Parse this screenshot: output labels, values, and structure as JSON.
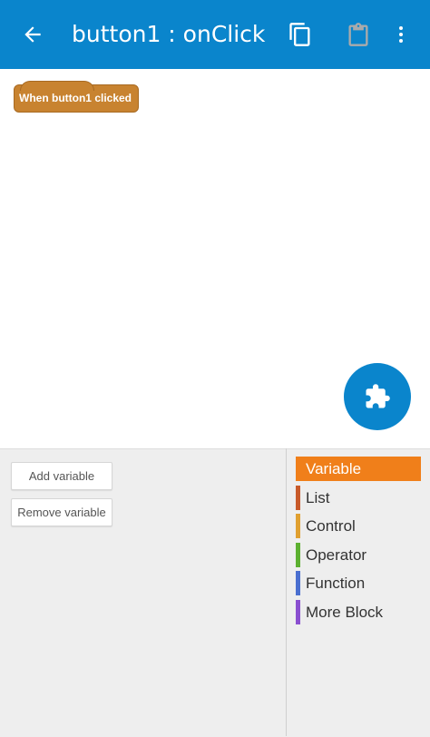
{
  "appbar": {
    "title": "button1 : onClick",
    "back_icon": "arrow-left-icon",
    "copy_icon": "copy-icon",
    "paste_icon": "clipboard-icon",
    "menu_icon": "more-vertical-icon",
    "bg_color": "#0a85cc"
  },
  "canvas": {
    "event_block": "When button1 clicked",
    "event_block_color": "#c88330",
    "fab_icon": "puzzle-piece-icon"
  },
  "palette": {
    "buttons": [
      "Add variable",
      "Remove variable"
    ],
    "categories": [
      {
        "label": "Variable",
        "color": "#f07f1a",
        "selected": true
      },
      {
        "label": "List",
        "color": "#c85a2a"
      },
      {
        "label": "Control",
        "color": "#e0a030"
      },
      {
        "label": "Operator",
        "color": "#5cb030"
      },
      {
        "label": "Function",
        "color": "#4a6fd0"
      },
      {
        "label": "More Block",
        "color": "#8a4fd0"
      }
    ]
  }
}
